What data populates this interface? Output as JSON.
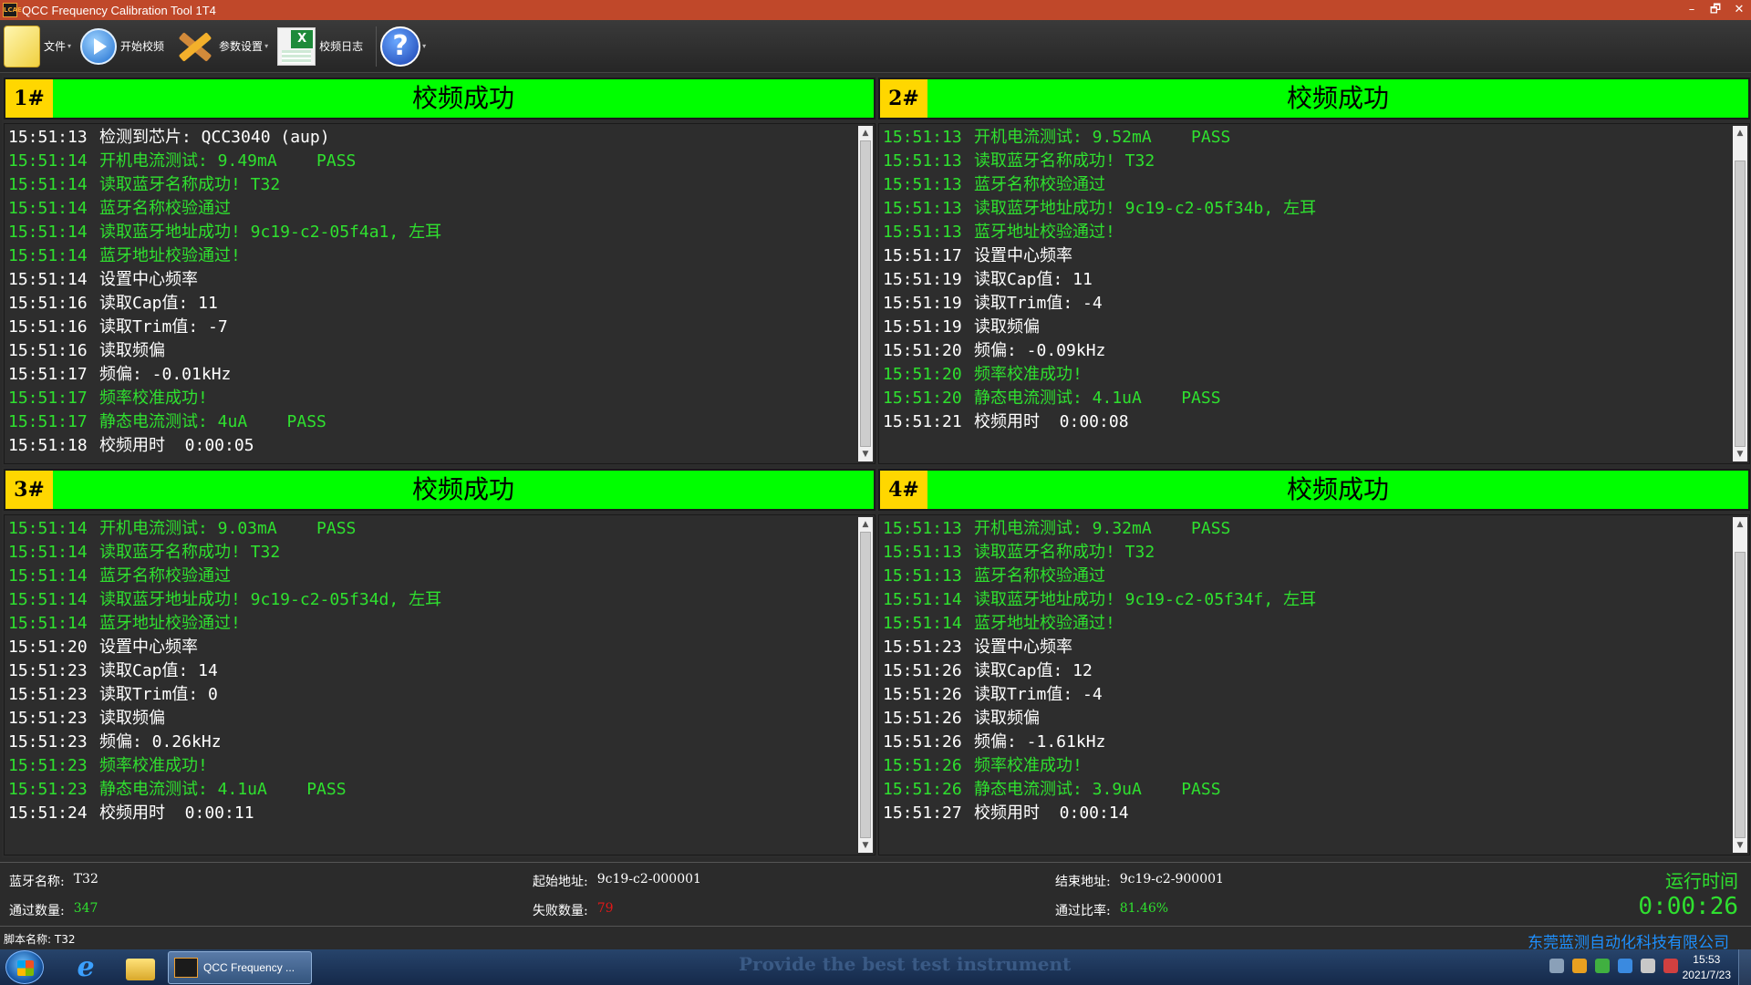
{
  "window": {
    "title": "QCC Frequency Calibration Tool 1T4",
    "app_icon_text": "LCAE",
    "controls": [
      "–",
      "🗗",
      "✕"
    ]
  },
  "toolbar": {
    "file_label": "文件",
    "start_label": "开始校频",
    "settings_label": "参数设置",
    "log_label": "校频日志",
    "help_label": "?"
  },
  "panels": [
    {
      "number": "1#",
      "status": "校频成功",
      "lines": [
        {
          "ts": "15:51:13",
          "text": "检测到芯片: QCC3040 (aup)",
          "color": "white"
        },
        {
          "ts": "15:51:14",
          "text": "开机电流测试: 9.49mA    PASS",
          "color": "green"
        },
        {
          "ts": "15:51:14",
          "text": "读取蓝牙名称成功! T32",
          "color": "green"
        },
        {
          "ts": "15:51:14",
          "text": "蓝牙名称校验通过",
          "color": "green"
        },
        {
          "ts": "15:51:14",
          "text": "读取蓝牙地址成功! 9c19-c2-05f4a1, 左耳",
          "color": "green"
        },
        {
          "ts": "15:51:14",
          "text": "蓝牙地址校验通过!",
          "color": "green"
        },
        {
          "ts": "15:51:14",
          "text": "设置中心频率",
          "color": "white"
        },
        {
          "ts": "15:51:16",
          "text": "读取Cap值: 11",
          "color": "white"
        },
        {
          "ts": "15:51:16",
          "text": "读取Trim值: -7",
          "color": "white"
        },
        {
          "ts": "15:51:16",
          "text": "读取频偏",
          "color": "white"
        },
        {
          "ts": "15:51:17",
          "text": "频偏: -0.01kHz",
          "color": "white"
        },
        {
          "ts": "15:51:17",
          "text": "频率校准成功!",
          "color": "green"
        },
        {
          "ts": "15:51:17",
          "text": "静态电流测试: 4uA    PASS",
          "color": "green"
        },
        {
          "ts": "15:51:18",
          "text": "校频用时  0:00:05",
          "color": "white"
        }
      ]
    },
    {
      "number": "2#",
      "status": "校频成功",
      "lines": [
        {
          "ts": "15:51:13",
          "text": "开机电流测试: 9.52mA    PASS",
          "color": "green"
        },
        {
          "ts": "15:51:13",
          "text": "读取蓝牙名称成功! T32",
          "color": "green"
        },
        {
          "ts": "15:51:13",
          "text": "蓝牙名称校验通过",
          "color": "green"
        },
        {
          "ts": "15:51:13",
          "text": "读取蓝牙地址成功! 9c19-c2-05f34b, 左耳",
          "color": "green"
        },
        {
          "ts": "15:51:13",
          "text": "蓝牙地址校验通过!",
          "color": "green"
        },
        {
          "ts": "15:51:17",
          "text": "设置中心频率",
          "color": "white"
        },
        {
          "ts": "15:51:19",
          "text": "读取Cap值: 11",
          "color": "white"
        },
        {
          "ts": "15:51:19",
          "text": "读取Trim值: -4",
          "color": "white"
        },
        {
          "ts": "15:51:19",
          "text": "读取频偏",
          "color": "white"
        },
        {
          "ts": "15:51:20",
          "text": "频偏: -0.09kHz",
          "color": "white"
        },
        {
          "ts": "15:51:20",
          "text": "频率校准成功!",
          "color": "green"
        },
        {
          "ts": "15:51:20",
          "text": "静态电流测试: 4.1uA    PASS",
          "color": "green"
        },
        {
          "ts": "15:51:21",
          "text": "校频用时  0:00:08",
          "color": "white"
        }
      ]
    },
    {
      "number": "3#",
      "status": "校频成功",
      "lines": [
        {
          "ts": "15:51:14",
          "text": "开机电流测试: 9.03mA    PASS",
          "color": "green"
        },
        {
          "ts": "15:51:14",
          "text": "读取蓝牙名称成功! T32",
          "color": "green"
        },
        {
          "ts": "15:51:14",
          "text": "蓝牙名称校验通过",
          "color": "green"
        },
        {
          "ts": "15:51:14",
          "text": "读取蓝牙地址成功! 9c19-c2-05f34d, 左耳",
          "color": "green"
        },
        {
          "ts": "15:51:14",
          "text": "蓝牙地址校验通过!",
          "color": "green"
        },
        {
          "ts": "15:51:20",
          "text": "设置中心频率",
          "color": "white"
        },
        {
          "ts": "15:51:23",
          "text": "读取Cap值: 14",
          "color": "white"
        },
        {
          "ts": "15:51:23",
          "text": "读取Trim值: 0",
          "color": "white"
        },
        {
          "ts": "15:51:23",
          "text": "读取频偏",
          "color": "white"
        },
        {
          "ts": "15:51:23",
          "text": "频偏: 0.26kHz",
          "color": "white"
        },
        {
          "ts": "15:51:23",
          "text": "频率校准成功!",
          "color": "green"
        },
        {
          "ts": "15:51:23",
          "text": "静态电流测试: 4.1uA    PASS",
          "color": "green"
        },
        {
          "ts": "15:51:24",
          "text": "校频用时  0:00:11",
          "color": "white"
        }
      ]
    },
    {
      "number": "4#",
      "status": "校频成功",
      "lines": [
        {
          "ts": "15:51:13",
          "text": "开机电流测试: 9.32mA    PASS",
          "color": "green"
        },
        {
          "ts": "15:51:13",
          "text": "读取蓝牙名称成功! T32",
          "color": "green"
        },
        {
          "ts": "15:51:13",
          "text": "蓝牙名称校验通过",
          "color": "green"
        },
        {
          "ts": "15:51:14",
          "text": "读取蓝牙地址成功! 9c19-c2-05f34f, 左耳",
          "color": "green"
        },
        {
          "ts": "15:51:14",
          "text": "蓝牙地址校验通过!",
          "color": "green"
        },
        {
          "ts": "15:51:23",
          "text": "设置中心频率",
          "color": "white"
        },
        {
          "ts": "15:51:26",
          "text": "读取Cap值: 12",
          "color": "white"
        },
        {
          "ts": "15:51:26",
          "text": "读取Trim值: -4",
          "color": "white"
        },
        {
          "ts": "15:51:26",
          "text": "读取频偏",
          "color": "white"
        },
        {
          "ts": "15:51:26",
          "text": "频偏: -1.61kHz",
          "color": "white"
        },
        {
          "ts": "15:51:26",
          "text": "频率校准成功!",
          "color": "green"
        },
        {
          "ts": "15:51:26",
          "text": "静态电流测试: 3.9uA    PASS",
          "color": "green"
        },
        {
          "ts": "15:51:27",
          "text": "校频用时  0:00:14",
          "color": "white"
        }
      ]
    }
  ],
  "info": {
    "bt_name_label": "蓝牙名称:",
    "bt_name": "T32",
    "start_addr_label": "起始地址:",
    "start_addr": "9c19-c2-000001",
    "end_addr_label": "结束地址:",
    "end_addr": "9c19-c2-900001",
    "pass_count_label": "通过数量:",
    "pass_count": "347",
    "fail_count_label": "失败数量:",
    "fail_count": "79",
    "pass_rate_label": "通过比率:",
    "pass_rate": "81.46%",
    "runtime_label": "运行时间",
    "runtime": "0:00:26"
  },
  "footer": {
    "script_name": "脚本名称: T32",
    "company": "东莞蓝测自动化科技有限公司"
  },
  "taskbar": {
    "active_task": "QCC Frequency ...",
    "tagline": "Provide the best test instrument",
    "time": "15:53",
    "date": "2021/7/23"
  },
  "colors": {
    "ok_green": "#00ff00",
    "number_yellow": "#ffd700",
    "log_green": "#2fe02f",
    "fail_red": "#e01818",
    "title_bar": "#c0482a",
    "company_blue": "#1e90ff"
  }
}
